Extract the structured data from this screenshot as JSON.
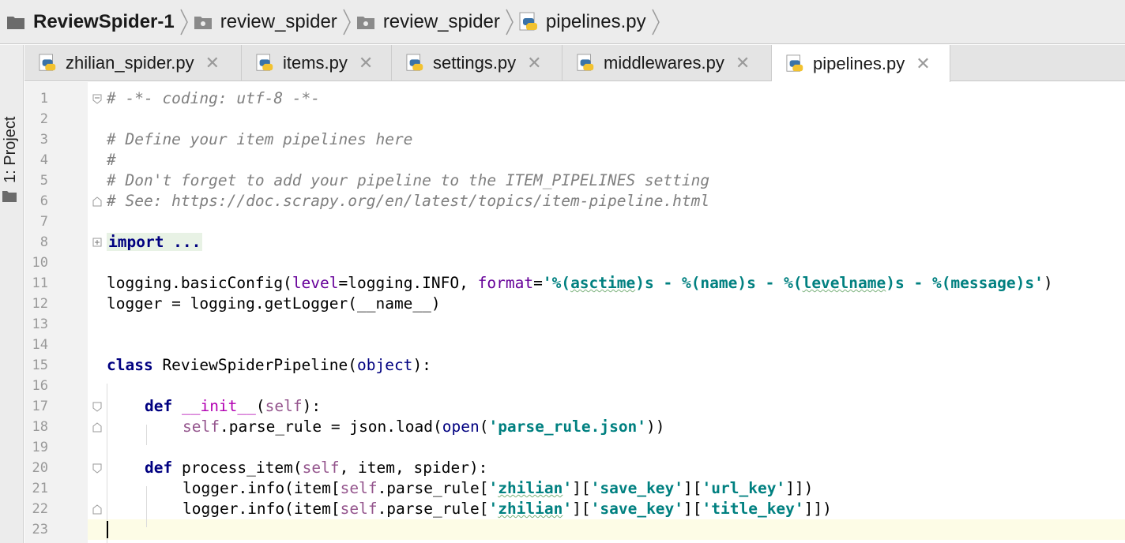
{
  "breadcrumb": {
    "project": "ReviewSpider-1",
    "folder1": "review_spider",
    "folder2": "review_spider",
    "file": "pipelines.py"
  },
  "toolstrip": {
    "project_label": "1: Project"
  },
  "tabs": [
    {
      "label": "zhilian_spider.py",
      "close": "✕"
    },
    {
      "label": "items.py",
      "close": "✕"
    },
    {
      "label": "settings.py",
      "close": "✕"
    },
    {
      "label": "middlewares.py",
      "close": "✕"
    },
    {
      "label": "pipelines.py",
      "close": "✕",
      "active": true
    }
  ],
  "editor": {
    "line_numbers": [
      "1",
      "2",
      "3",
      "4",
      "5",
      "6",
      "7",
      "8",
      "10",
      "11",
      "12",
      "13",
      "14",
      "15",
      "16",
      "17",
      "18",
      "19",
      "20",
      "21",
      "22",
      "23"
    ],
    "code": {
      "l1": "# -*- coding: utf-8 -*-",
      "l3": "# Define your item pipelines here",
      "l4": "#",
      "l5": "# Don't forget to add your pipeline to the ITEM_PIPELINES setting",
      "l6": "# See: https://doc.scrapy.org/en/latest/topics/item-pipeline.html",
      "l8": "import ...",
      "l11_a": "logging.basicConfig(",
      "l11_b": "level",
      "l11_c": "=logging.INFO, ",
      "l11_d": "format",
      "l11_e": "=",
      "l11_f": "'%(",
      "l11_g": "asctime",
      "l11_h": ")s - %(name)s - %(",
      "l11_i": "levelname",
      "l11_j": ")s - %(message)s'",
      "l11_k": ")",
      "l12_a": "logger = logging.getLogger(",
      "l12_b": "__name__",
      "l12_c": ")",
      "l15_a": "class",
      "l15_b": " ReviewSpiderPipeline(",
      "l15_c": "object",
      "l15_d": "):",
      "l17_a": "def",
      "l17_b": " __init__",
      "l17_c": "(",
      "l17_d": "self",
      "l17_e": "):",
      "l18_a": "self",
      "l18_b": ".parse_rule = json.load(",
      "l18_c": "open",
      "l18_d": "(",
      "l18_e": "'parse_rule.json'",
      "l18_f": "))",
      "l20_a": "def",
      "l20_b": " process_item(",
      "l20_c": "self",
      "l20_d": ", item, spider):",
      "l21_a": "logger.info(item[",
      "l21_b": "self",
      "l21_c": ".parse_rule[",
      "l21_d": "'",
      "l21_e": "zhilian",
      "l21_f": "'",
      "l21_g": "][",
      "l21_h": "'save_key'",
      "l21_i": "][",
      "l21_j": "'url_key'",
      "l21_k": "]])",
      "l22_a": "logger.info(item[",
      "l22_b": "self",
      "l22_c": ".parse_rule[",
      "l22_d": "'",
      "l22_e": "zhilian",
      "l22_f": "'",
      "l22_g": "][",
      "l22_h": "'save_key'",
      "l22_i": "][",
      "l22_j": "'title_key'",
      "l22_k": "]])"
    }
  },
  "icons": {
    "folder": "folder-icon",
    "python_file": "python-file-icon",
    "close": "close-icon",
    "chevron": "chevron-right-icon"
  },
  "colors": {
    "comment": "#808080",
    "keyword": "#000080",
    "string": "#008080",
    "self": "#94558d",
    "current_line": "#fdfce6"
  }
}
